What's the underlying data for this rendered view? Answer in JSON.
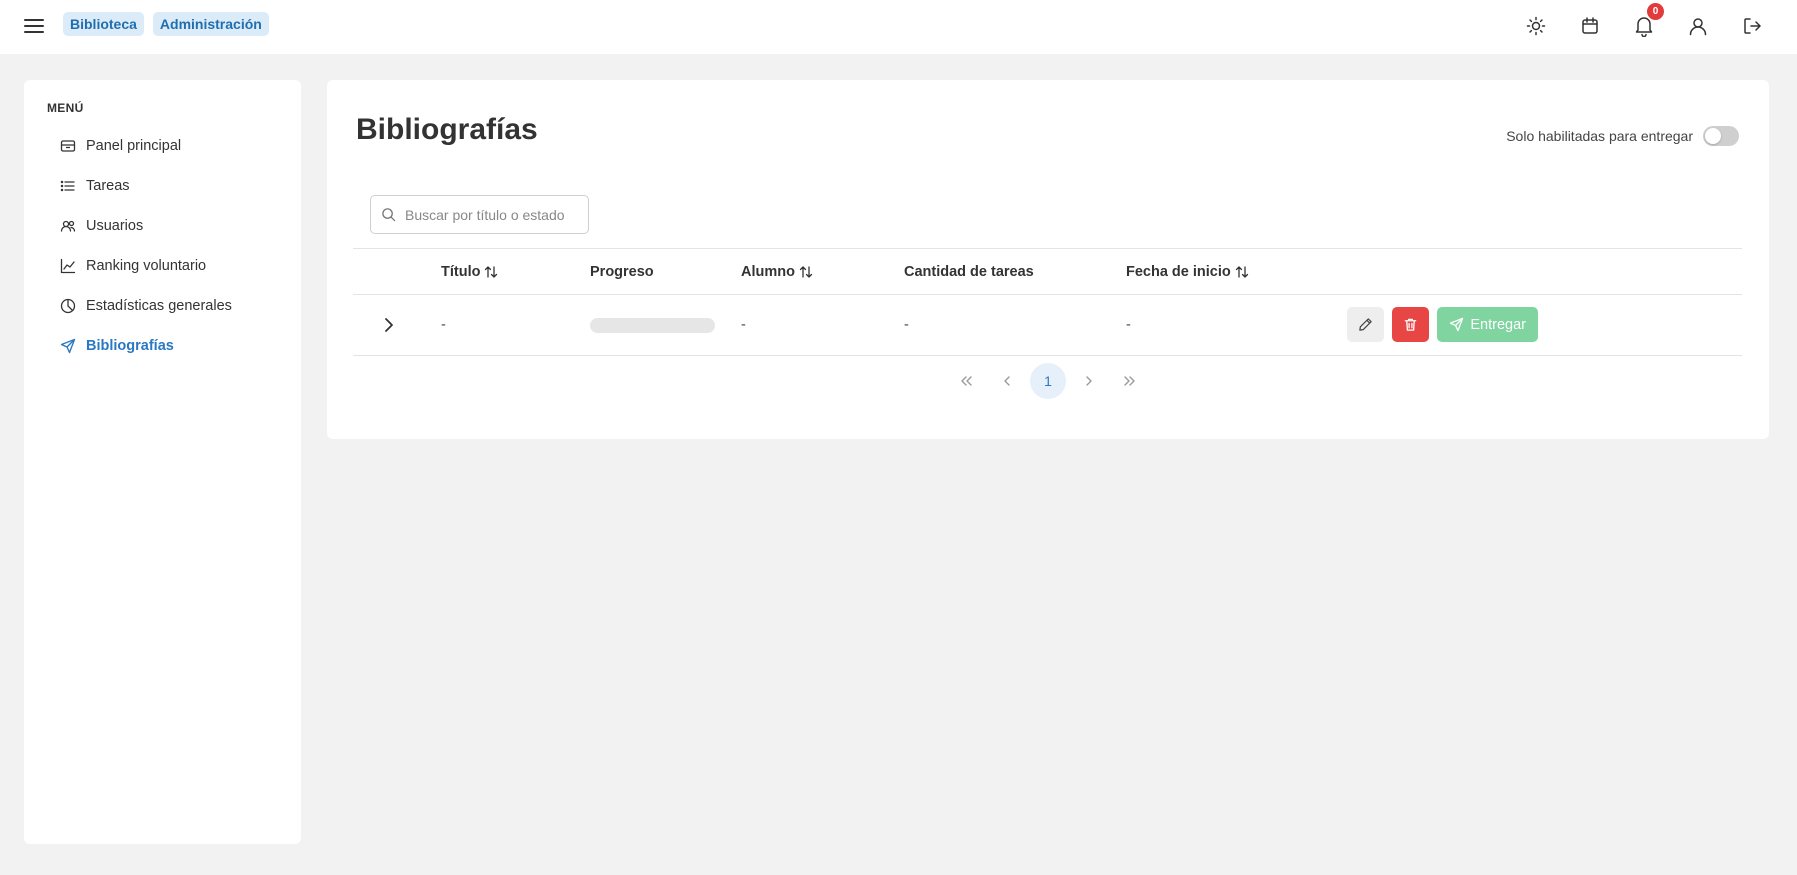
{
  "breadcrumbs": [
    "Biblioteca",
    "Administración"
  ],
  "topbar": {
    "icons": [
      "sun-icon",
      "calendar-icon",
      "bell-icon",
      "user-icon",
      "logout-icon"
    ],
    "notification_count": "0"
  },
  "sidebar": {
    "menu_title": "MENÚ",
    "items": [
      {
        "label": "Panel principal",
        "icon": "dashboard-icon"
      },
      {
        "label": "Tareas",
        "icon": "list-icon"
      },
      {
        "label": "Usuarios",
        "icon": "users-icon"
      },
      {
        "label": "Ranking voluntario",
        "icon": "chart-line-icon"
      },
      {
        "label": "Estadísticas generales",
        "icon": "pie-chart-icon"
      },
      {
        "label": "Bibliografías",
        "icon": "send-icon",
        "active": true
      }
    ]
  },
  "main": {
    "title": "Bibliografías",
    "toggle_label": "Solo habilitadas para entregar",
    "toggle_on": false,
    "search_placeholder": "Buscar por título o estado",
    "search_value": "",
    "columns": [
      {
        "label": "Título",
        "sortable": true
      },
      {
        "label": "Progreso",
        "sortable": false
      },
      {
        "label": "Alumno",
        "sortable": true
      },
      {
        "label": "Cantidad de tareas",
        "sortable": false
      },
      {
        "label": "Fecha de inicio",
        "sortable": true
      }
    ],
    "rows": [
      {
        "titulo": "-",
        "progreso": 0,
        "alumno": "-",
        "cantidad": "-",
        "fecha": "-",
        "deliver_label": "Entregar"
      }
    ],
    "pagination": {
      "current_page": "1"
    }
  },
  "colors": {
    "accent": "#2b78c2",
    "badge_bg": "#dcebf8",
    "delete": "#e84545",
    "deliver": "#7fd4a0",
    "notification": "#e23b3b"
  }
}
